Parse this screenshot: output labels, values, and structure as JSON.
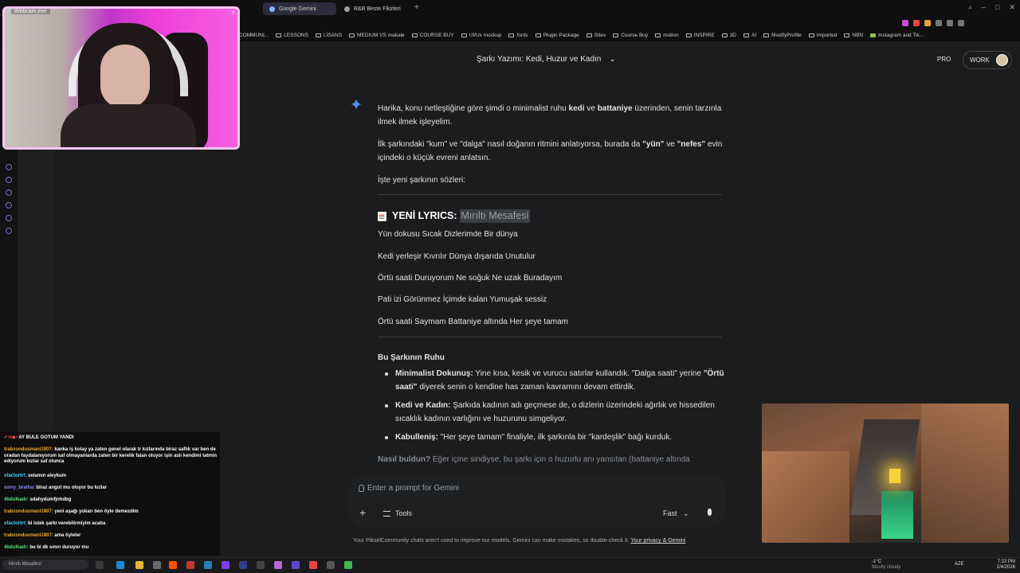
{
  "browser": {
    "tabs": [
      {
        "label": "Google Gemini",
        "active": true,
        "color": "#8ab4f8"
      },
      {
        "label": "R&B Beste Fikirleri",
        "active": false,
        "color": "#9aa0a6"
      }
    ],
    "new_tab": "+",
    "bookmarks": [
      "COMMUNI...",
      "LESSONS",
      "LİSANS",
      "MEDIUM VS makale",
      "COURSE BUY",
      "UI/Ux mockup",
      "fonts",
      "Plugin Package",
      "Sites",
      "Course Buy",
      "motion",
      "INSPIRE",
      "3D",
      "AI",
      "ModifyProfile",
      "Imported",
      "NBN",
      "Instagram and Tik..."
    ]
  },
  "header": {
    "title": "Şarkı Yazımı: Kedi, Huzur ve Kadın",
    "pro": "PRO",
    "work": "WORK"
  },
  "chat": {
    "intro1": "Harika, konu netleştiğine göre şimdi o minimalist ruhu kedi ve battaniye üzerinden, senin tarzınla ilmek ilmek işleyelim.",
    "intro2": "İlk şarkındaki \"kum\" ve \"dalga\" nasıl doğanın ritmini anlatıyorsa, burada da \"yün\" ve \"nefes\" evin içindeki o küçük evreni anlatsın.",
    "intro3": "İşte yeni şarkının sözleri:",
    "lyrics_heading": "YENİ LYRICS:",
    "lyrics_title": "Mırıltı Mesafesi",
    "lyrics": [
      "Yün dokusu Sıcak Dizlerimde Bir dünya",
      "Kedi yerleşir Kıvrılır Dünya dışarıda Unutulur",
      "Örtü saati Duruyorum Ne soğuk Ne uzak Buradayım",
      "Pati izi Görünmez İçimde kalan Yumuşak sessiz",
      "Örtü saati Saymam Battaniye altında Her şeye tamam"
    ],
    "section_heading": "Bu Şarkının Ruhu",
    "bullets": [
      {
        "bold": "Minimalist Dokunuş:",
        "text": " Yine kısa, kesik ve vurucu satırlar kullandık. \"Dalga saati\" yerine ",
        "bold2": "\"Örtü saati\"",
        "text2": " diyerek senin o kendine has zaman kavramını devam ettirdik."
      },
      {
        "bold": "Kedi ve Kadın:",
        "text": " Şarkıda kadının adı geçmese de, o dizlerin üzerindeki ağırlık ve hissedilen sıcaklık kadının varlığını ve huzurunu simgeliyor.",
        "bold2": "",
        "text2": ""
      },
      {
        "bold": "Kabulleniş:",
        "text": " \"Her şeye tamam\" finaliyle, ilk şarkınla bir \"kardeşlik\" bağı kurduk.",
        "bold2": "",
        "text2": ""
      }
    ],
    "fade_bold": "Nasıl buldun?",
    "fade_text": " Eğer içine sindiyse, bu şarkı için o huzurlu anı yansıtan (battaniye altında"
  },
  "prompt": {
    "placeholder": "Enter a prompt for Gemini",
    "tools": "Tools",
    "mode": "Fast",
    "disclaimer": "Your PikselCommunity chats aren't used to improve our models. Gemini can make mistakes, so double-check it.",
    "privacy_link": "Your privacy & Gemini"
  },
  "webcam": {
    "label": "Webcam.exe",
    "close": "×"
  },
  "stream_chat": [
    {
      "user": "",
      "text": "AY BULE GOTUM YANDI",
      "color": "#ff4d4d"
    },
    {
      "user": "trabzondusmani1907:",
      "text": " kanka iş kolay ya zaten genel olarak tr kızlarında biraz saflık var ben de oradan faydalanıyorum saf olmayanlarda zaten bir kerelik falan oluyor işin aslı kendimi tatmin ediyorum kızlar saf olunca",
      "color": "#f0a83c"
    },
    {
      "user": "xfactortrt:",
      "text": " selamın aleykum",
      "color": "#4dd6ff"
    },
    {
      "user": "sorry_bratha:",
      "text": " biraz angut mu oluyor bu kızlar",
      "color": "#8f8fff"
    },
    {
      "user": "4bdulkadr:",
      "text": " sdahydumfjnhdbg",
      "color": "#5be07a"
    },
    {
      "user": "trabzondusmani1907:",
      "text": " yeni aşağı yukarı ben öyle demezdim",
      "color": "#f0a83c"
    },
    {
      "user": "xfactortrt:",
      "text": " bi istek şarkı verebilirmiyim acaba",
      "color": "#4dd6ff"
    },
    {
      "user": "trabzondusmani1907:",
      "text": " ama öyleler",
      "color": "#f0a83c"
    },
    {
      "user": "4bdulkadr:",
      "text": " bu bi dk sınırı duruyor mu",
      "color": "#5be07a"
    }
  ],
  "taskbar": {
    "search": "Mırıltı Mesafesi",
    "weather_temp": "-1°C",
    "weather_desc": "Mostly cloudy",
    "lang": "AZE",
    "time": "7:22 PM",
    "date": "2/4/2026"
  }
}
